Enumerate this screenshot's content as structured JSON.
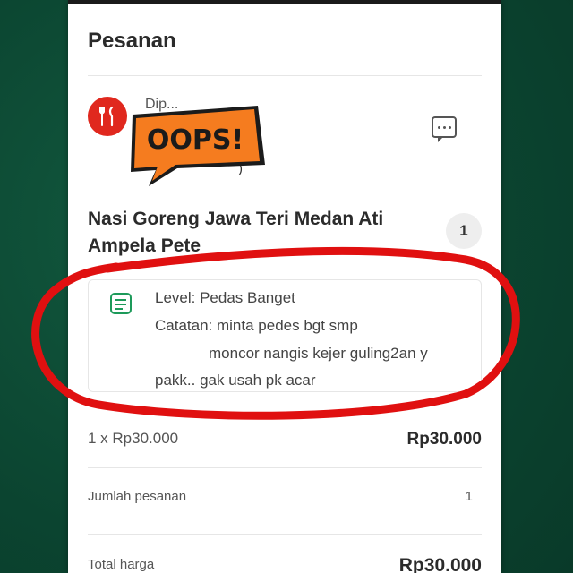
{
  "header": {
    "title": "Pesanan"
  },
  "restaurant": {
    "name_partial": "Dip...",
    "sub_partial": ")",
    "logo_icon": "utensils-icon",
    "chat_icon": "chat-bubble-icon"
  },
  "sticker": {
    "text": "OOPS!",
    "color": "#f57c1f"
  },
  "item": {
    "name": "Nasi Goreng Jawa Teri Medan Ati Ampela Pete",
    "quantity": "1",
    "note_icon": "note-icon",
    "level": "Level: Pedas Banget",
    "note_line1": "Catatan: minta pedes bgt smp",
    "note_line2": "moncor nangis kejer guling2an y",
    "note_line3": "pakk.. gak usah pk acar",
    "unit_price": "1 x Rp30.000",
    "line_total": "Rp30.000"
  },
  "summary": {
    "count_label": "Jumlah pesanan",
    "count_value": "1",
    "total_label": "Total harga",
    "total_value": "Rp30.000"
  },
  "colors": {
    "background": "#0d4a33",
    "brand_red": "#e0281e",
    "note_green": "#1d9a5a",
    "annotation_red": "#e01010"
  }
}
